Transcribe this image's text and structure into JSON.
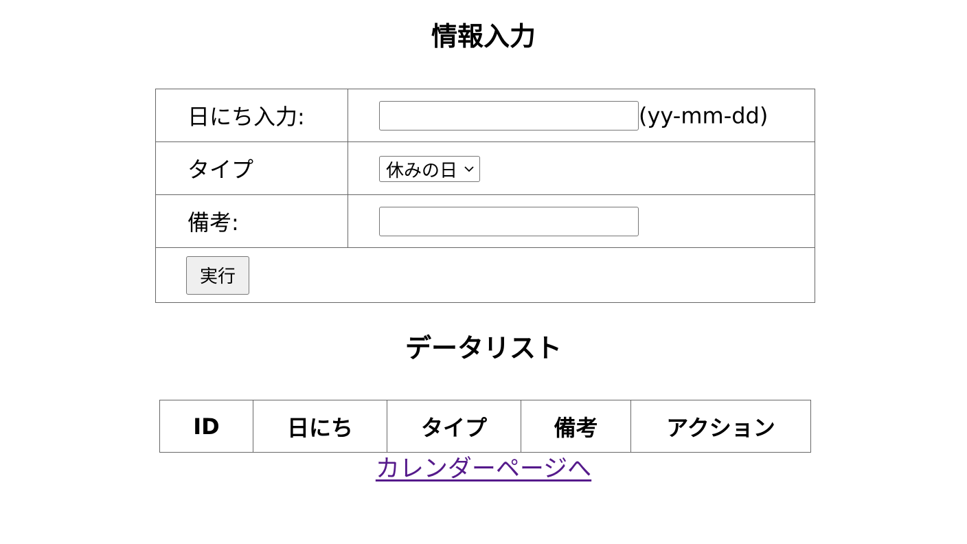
{
  "form": {
    "title": "情報入力",
    "date_label": "日にち入力:",
    "date_value": "",
    "date_format_hint": "(yy-mm-dd)",
    "type_label": "タイプ",
    "type_selected": "休みの日",
    "note_label": "備考:",
    "note_value": "",
    "submit_label": "実行"
  },
  "list": {
    "title": "データリスト",
    "columns": [
      "ID",
      "日にち",
      "タイプ",
      "備考",
      "アクション"
    ]
  },
  "link": {
    "calendar_label": "カレンダーページへ"
  },
  "colors": {
    "link": "#551a8b",
    "button_bg": "#efefef",
    "border": "#666666"
  }
}
